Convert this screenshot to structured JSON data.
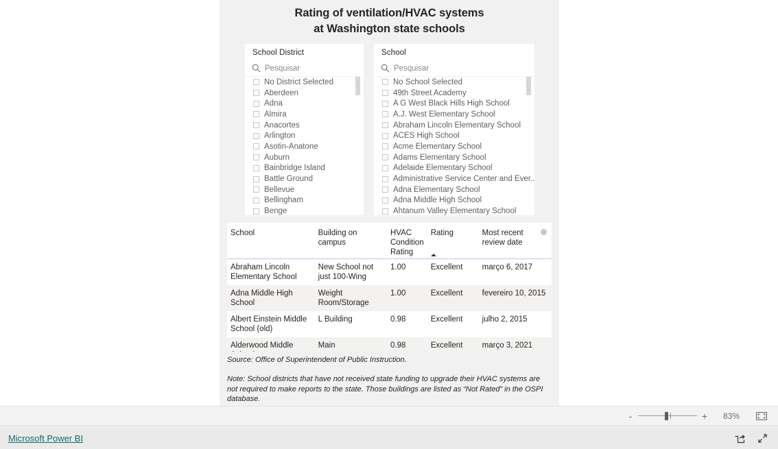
{
  "report": {
    "title_line1": "Rating of ventilation/HVAC systems",
    "title_line2": "at Washington state schools"
  },
  "district_slicer": {
    "header": "School District",
    "search_placeholder": "Pesquisar",
    "search_icon": "search-icon",
    "items": [
      "No District Selected",
      "Aberdeen",
      "Adna",
      "Almira",
      "Anacortes",
      "Arlington",
      "Asotin-Anatone",
      "Auburn",
      "Bainbridge Island",
      "Battle Ground",
      "Bellevue",
      "Bellingham",
      "Benge"
    ]
  },
  "school_slicer": {
    "header": "School",
    "search_placeholder": "Pesquisar",
    "search_icon": "search-icon",
    "items": [
      "No School Selected",
      "49th Street Academy",
      "A G West Black Hills High School",
      "A.J. West Elementary School",
      "Abraham Lincoln Elementary School",
      "ACES High School",
      "Acme Elementary School",
      "Adams Elementary School",
      "Adelaide Elementary School",
      "Administrative Service Center and Ever...",
      "Adna Elementary School",
      "Adna Middle High School",
      "Ahtanum Valley Elementary School"
    ]
  },
  "table": {
    "columns": [
      "School",
      "Building on campus",
      "HVAC Condition Rating",
      "Rating",
      "Most recent review date"
    ],
    "sort_column": "Rating",
    "sort_direction": "ascending",
    "rows": [
      {
        "school": "Abraham Lincoln Elementary School",
        "building": "New School not just 100-Wing",
        "hvac": "1.00",
        "rating": "Excellent",
        "date": "março 6, 2017"
      },
      {
        "school": "Adna Middle High School",
        "building": "Weight Room/Storage",
        "hvac": "1.00",
        "rating": "Excellent",
        "date": "fevereiro 10, 2015"
      },
      {
        "school": "Albert Einstein Middle School (old)",
        "building": "L Building",
        "hvac": "0.98",
        "rating": "Excellent",
        "date": "julho 2, 2015"
      },
      {
        "school": "Alderwood Middle School",
        "building": "Main",
        "hvac": "0.98",
        "rating": "Excellent",
        "date": "março 3, 2021"
      }
    ]
  },
  "footnotes": {
    "source": "Source: Office of Superintendent of Public Instruction.",
    "note": "Note: School districts that have not received state funding to upgrade their HVAC systems are not required to make reports to the state. Those buildings are listed as “Not Rated” in the OSPI database."
  },
  "statusbar": {
    "zoom_out_label": "-",
    "zoom_in_label": "+",
    "zoom_level": "83%",
    "fit_icon": "fit-to-page-icon"
  },
  "footer": {
    "brand": "Microsoft Power BI",
    "share_icon": "share-icon",
    "fullscreen_icon": "fullscreen-icon"
  },
  "colors": {
    "canvas": "#f1f1f1",
    "panel": "#ffffff",
    "text": "#252423",
    "muted": "#605e5c",
    "placeholder": "#8a8886",
    "header_rule": "#b8cce4",
    "row_alt": "#f3f2f1",
    "brand_link": "#0f6c6c"
  }
}
